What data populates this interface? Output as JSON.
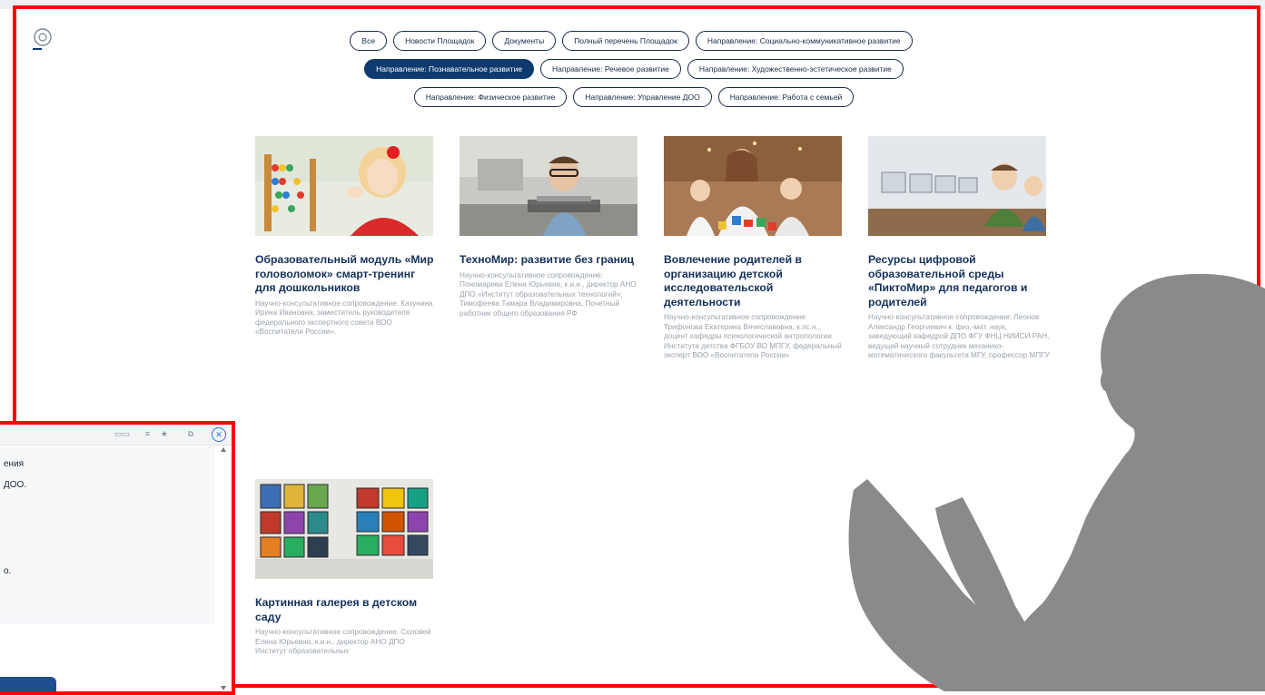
{
  "filters": {
    "row1": [
      "Все",
      "Новости Площадок",
      "Документы",
      "Полный перечень Площадок",
      "Направление: Социально-коммуникативное развитие"
    ],
    "row2": [
      "Направление: Познавательное развитие",
      "Направление: Речевое развитие",
      "Направление: Художественно-эстетическое развитие"
    ],
    "row3": [
      "Направление: Физическое развитие",
      "Направление: Управление ДОО",
      "Направление: Работа с семьей"
    ],
    "active": "Направление: Познавательное развитие"
  },
  "cards": [
    {
      "title": "Образовательный модуль «Мир головоломок» смарт-тренинг для дошкольников",
      "desc": "Научно-консультативное сопровождение: Казунина Ирина Ивановна, заместитель руководителя федерального экспертного совета ВОО «Воспитатели России»."
    },
    {
      "title": "ТехноМир: развитие без границ",
      "desc": "Научно-консультативное сопровождение: Пономарева Елена Юрьевна, к.и.н., директор АНО ДПО «Институт образовательных технологий»; Тимофеева Тамара Владимировна, Почетный работник общего образования РФ"
    },
    {
      "title": "Вовлечение родителей в организацию детской исследовательской деятельности",
      "desc": "Научно-консультативное сопровождение: Трифонова Екатерина Вячеславовна, к.пс.н., доцент кафедры психологической антропологии Института детства ФГБОУ ВО МПГУ, федеральный эксперт ВОО «Воспитатели России»"
    },
    {
      "title": "Ресурсы цифровой образовательной среды «ПиктоМир» для педагогов и родителей",
      "desc": "Научно-консультативное сопровождение: Леонов Александр Георгиевич к. физ.-мат. наук, заведующий кафедрой ДПО ФГУ ФНЦ НИИСИ РАН, ведущий научный сотрудник механико-математического факультета МГУ, профессор МПГУ"
    },
    {
      "title": "Картинная галерея в детском саду",
      "desc": "Научно-консультативное сопровождение: Соловей Елена Юрьевна, к.и.н., директор АНО ДПО Институт образовательных"
    }
  ],
  "subwindow": {
    "line1": "ения",
    "line2": "ДОО.",
    "line3": "о."
  },
  "colors": {
    "frame": "#ff0000",
    "accent": "#0f3a6e",
    "title": "#14305a",
    "silhouette": "#8a8a8a"
  },
  "icons": [
    "site-logo-icon",
    "close-icon",
    "person-reading-silhouette"
  ]
}
